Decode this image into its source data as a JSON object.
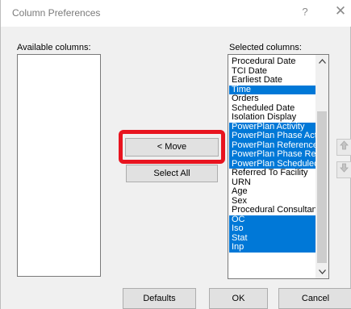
{
  "window": {
    "title": "Column Preferences",
    "help_glyph": "?",
    "close_glyph": "✕"
  },
  "available": {
    "label": "Available columns:",
    "items": []
  },
  "selected": {
    "label": "Selected columns:",
    "items": [
      {
        "label": "Procedural Date",
        "selected": false
      },
      {
        "label": "TCI Date",
        "selected": false
      },
      {
        "label": "Earliest Date",
        "selected": false
      },
      {
        "label": "Time",
        "selected": true
      },
      {
        "label": "Orders",
        "selected": false
      },
      {
        "label": "Scheduled Date",
        "selected": false
      },
      {
        "label": "Isolation Display",
        "selected": false
      },
      {
        "label": "PowerPlan Activity",
        "selected": true
      },
      {
        "label": "PowerPlan Phase Acti",
        "selected": true
      },
      {
        "label": "PowerPlan Reference",
        "selected": true
      },
      {
        "label": "PowerPlan Phase Refe",
        "selected": true
      },
      {
        "label": "PowerPlan Scheduled",
        "selected": true
      },
      {
        "label": "Referred To Facility",
        "selected": false
      },
      {
        "label": "URN",
        "selected": false
      },
      {
        "label": "Age",
        "selected": false
      },
      {
        "label": "Sex",
        "selected": false
      },
      {
        "label": "Procedural Consultant",
        "selected": false
      },
      {
        "label": "OC",
        "selected": true
      },
      {
        "label": "Iso",
        "selected": true
      },
      {
        "label": "Stat",
        "selected": true
      },
      {
        "label": "Inp",
        "selected": true
      }
    ],
    "selection_color": "#0078d7"
  },
  "buttons": {
    "move": "< Move",
    "select_all": "Select All",
    "move_up_icon": "move-up-icon",
    "move_down_icon": "move-down-icon",
    "defaults": "Defaults",
    "ok": "OK",
    "cancel": "Cancel"
  },
  "annotation": {
    "highlight_color": "#e8141f"
  }
}
